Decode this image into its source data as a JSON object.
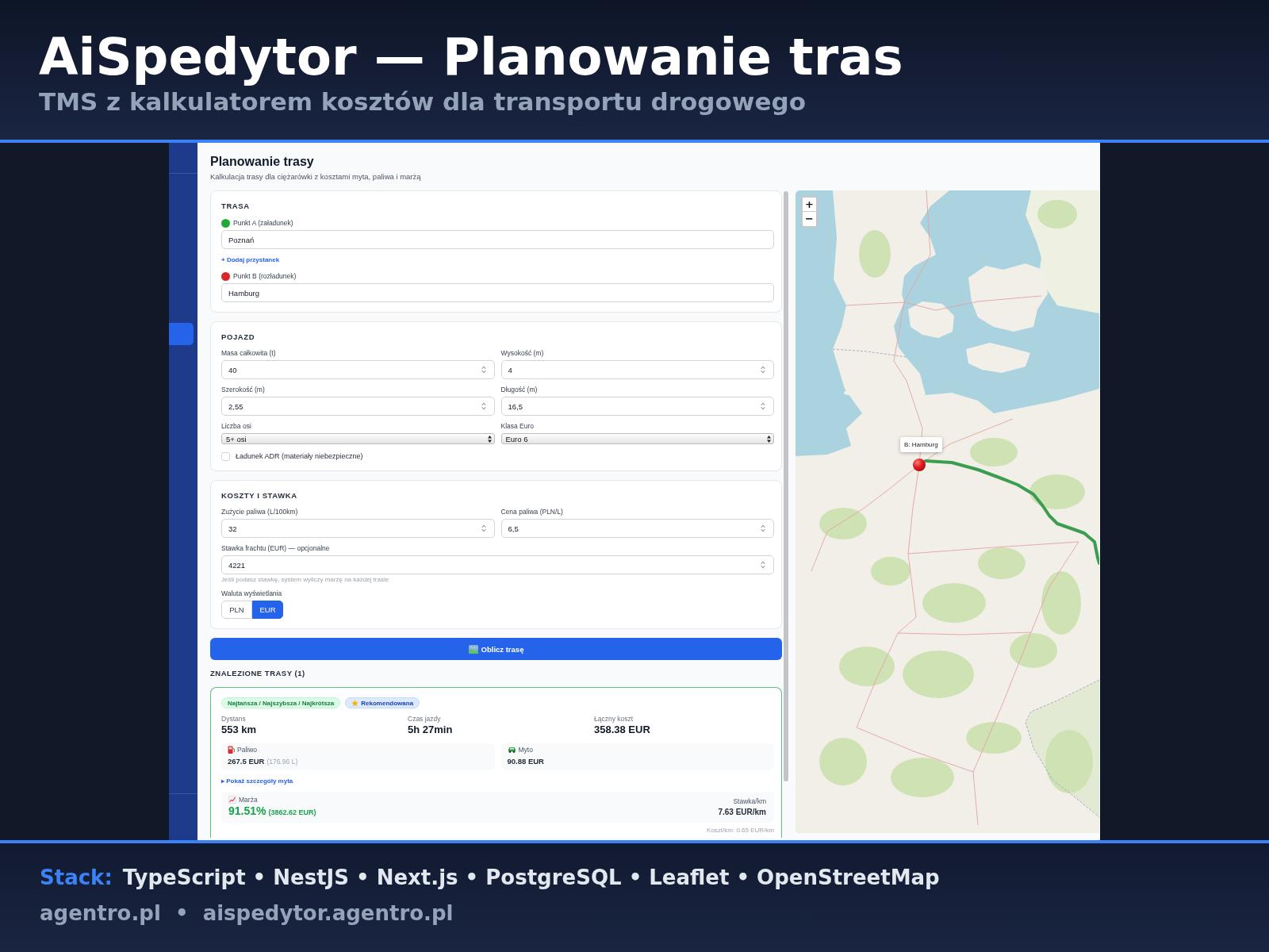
{
  "banner": {
    "title": "AiSpedytor — Planowanie tras",
    "subtitle": "TMS z kalkulatorem kosztów dla transportu drogowego"
  },
  "sidebar": {
    "items": [
      {
        "selected": true
      }
    ]
  },
  "page": {
    "title": "Planowanie trasy",
    "subtitle": "Kalkulacja trasy dla ciężarówki z kosztami myta, paliwa i marżą"
  },
  "route": {
    "heading": "TRASA",
    "stops": [
      {
        "label": "Punkt A (załadunek)",
        "color": "#22a834",
        "value": "Poznań"
      },
      {
        "label": "Punkt B (rozładunek)",
        "color": "#dc2626",
        "value": "Hamburg"
      }
    ],
    "add_stop": "+ Dodaj przystanek"
  },
  "vehicle": {
    "heading": "POJAZD",
    "fields": [
      {
        "kind": "number",
        "label": "Masa całkowita (t)",
        "value": "40"
      },
      {
        "kind": "number",
        "label": "Wysokość (m)",
        "value": "4"
      },
      {
        "kind": "number",
        "label": "Szerokość (m)",
        "value": "2,55"
      },
      {
        "kind": "number",
        "label": "Długość (m)",
        "value": "16,5"
      },
      {
        "kind": "select",
        "label": "Liczba osi",
        "value": "5+ osi"
      },
      {
        "kind": "select",
        "label": "Klasa Euro",
        "value": "Euro 6"
      }
    ],
    "adr": {
      "label": "Ładunek ADR (materiały niebezpieczne)",
      "checked": false
    }
  },
  "costs": {
    "heading": "KOSZTY I STAWKA",
    "fields": [
      {
        "kind": "number",
        "label": "Zużycie paliwa (L/100km)",
        "value": "32"
      },
      {
        "kind": "number",
        "label": "Cena paliwa (PLN/L)",
        "value": "6,5"
      }
    ],
    "freight": {
      "label": "Stawka frachtu (EUR) — opcjonalne",
      "value": "4221",
      "hint": "Jeśli podasz stawkę, system wyliczy marżę na każdej trasie"
    },
    "currency": {
      "label": "Waluta wyświetlania",
      "options": [
        {
          "label": "PLN",
          "selected": false
        },
        {
          "label": "EUR",
          "selected": true
        }
      ]
    }
  },
  "calculate_button": "Oblicz trasę",
  "results": {
    "heading": "ZNALEZIONE TRASY (1)",
    "routes": [
      {
        "selected": true,
        "badges": [
          {
            "kind": "best",
            "label": "Najtańsza / Najszybsza / Najkrótsza"
          },
          {
            "kind": "recommended",
            "label": "Rekomendowana"
          }
        ],
        "stats": [
          {
            "label": "Dystans",
            "value": "553 km"
          },
          {
            "label": "Czas jazdy",
            "value": "5h 27min"
          },
          {
            "label": "Łączny koszt",
            "value": "358.38 EUR"
          }
        ],
        "costs": [
          {
            "kind": "fuel",
            "label": "Paliwo",
            "value": "267.5 EUR",
            "note": "(176.96 L)"
          },
          {
            "kind": "toll",
            "label": "Myto",
            "value": "90.88 EUR"
          }
        ],
        "toll_details": "▸ Pokaż szczegóły myta",
        "margin": {
          "label": "Marża",
          "percent": "91.51%",
          "amount": "(3862.62 EUR)",
          "rate_label": "Stawka/km",
          "rate": "7.63 EUR/km"
        },
        "cost_per_km": "Koszt/km: 0.65 EUR/km"
      }
    ]
  },
  "map": {
    "zoom_in": "+",
    "zoom_out": "−",
    "popup": "B: Hamburg"
  },
  "footer": {
    "stack_label": "Stack:",
    "stack": "TypeScript • NestJS • Next.js • PostgreSQL • Leaflet • OpenStreetMap",
    "sites": "agentro.pl  •  aispedytor.agentro.pl"
  }
}
